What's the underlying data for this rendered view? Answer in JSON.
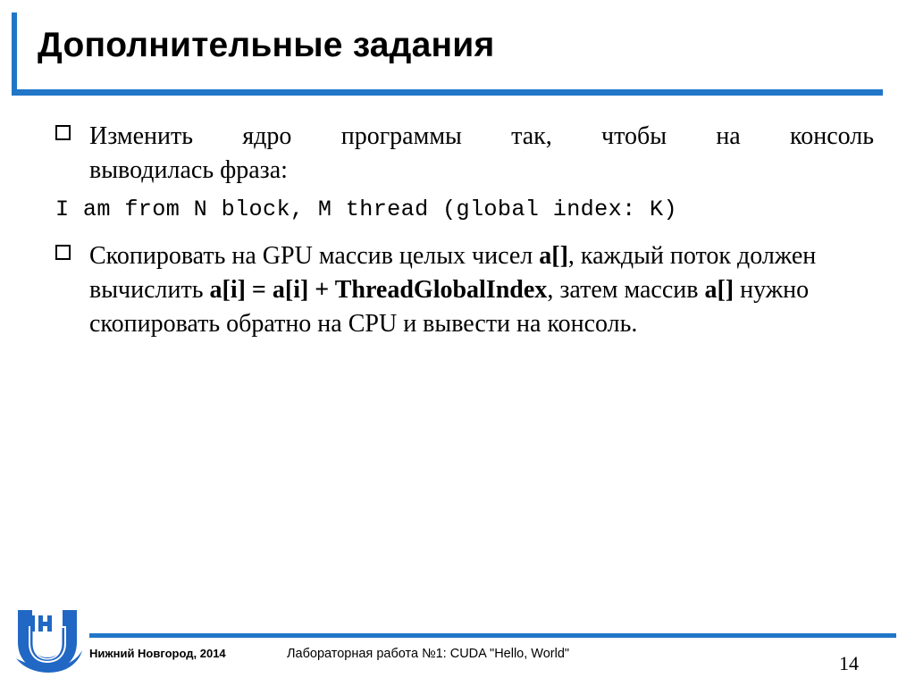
{
  "slide": {
    "title": "Дополнительные задания",
    "page_number": "14",
    "accent_color": "#2176C7",
    "background_color": "#FFFFFF",
    "text_color": "#000000"
  },
  "body": {
    "bullets": [
      {
        "marker": "hollow-square-bullet",
        "text": "Изменить ядро программы так, чтобы на консоль выводилась фраза:"
      },
      {
        "marker": "hollow-square-bullet",
        "text": "Скопировать на GPU массив целых чисел a[], каждый поток должен вычислить a[i] = a[i] + ThreadGlobalIndex, затем массив a[] нужно скопировать обратно на CPU и вывести на консоль."
      }
    ],
    "bullet1_line1": "Изменить ядро программы так, чтобы на консоль",
    "bullet1_line2": "выводилась фраза:",
    "code_line": "I am from N block, M thread (global index: K)",
    "bullet2_seg1": "Скопировать на GPU массив целых чисел ",
    "bullet2_seg2_bold": "a[]",
    "bullet2_seg3": ", каждый поток должен вычислить ",
    "bullet2_seg4_bold": "a[i] = a[i] + ThreadGlobalIndex",
    "bullet2_seg5": ", затем массив ",
    "bullet2_seg6_bold": "a[]",
    "bullet2_seg7": " нужно скопировать обратно на CPU и вывести на консоль."
  },
  "footer": {
    "left": "Нижний Новгород, 2014",
    "center": "Лабораторная работа №1: CUDA \"Hello, World\"",
    "page": "14",
    "logo_name": "unn-lobachevsky-university-logo",
    "logo_letters": "НН",
    "logo_color": "#2167C4"
  }
}
